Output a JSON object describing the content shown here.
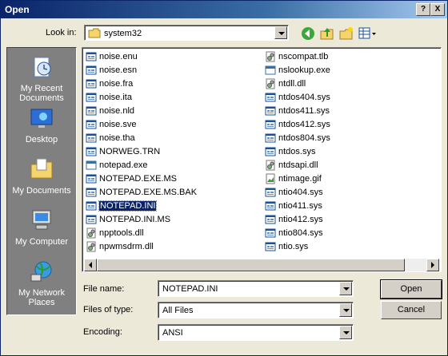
{
  "window": {
    "title": "Open",
    "help_label": "?",
    "close_label": "X"
  },
  "lookin": {
    "label": "Look in:",
    "value": "system32"
  },
  "places": [
    {
      "label": "My Recent Documents",
      "icon": "recent-documents-icon"
    },
    {
      "label": "Desktop",
      "icon": "desktop-icon"
    },
    {
      "label": "My Documents",
      "icon": "my-documents-icon"
    },
    {
      "label": "My Computer",
      "icon": "my-computer-icon"
    },
    {
      "label": "My Network Places",
      "icon": "network-places-icon"
    }
  ],
  "files_col1": [
    "noise.enu",
    "noise.esn",
    "noise.fra",
    "noise.ita",
    "noise.nld",
    "noise.sve",
    "noise.tha",
    "NORWEG.TRN",
    "notepad.exe",
    "NOTEPAD.EXE.MS",
    "NOTEPAD.EXE.MS.BAK",
    "NOTEPAD.INI",
    "NOTEPAD.INI.MS",
    "npptools.dll",
    "npwmsdrm.dll"
  ],
  "files_col2": [
    "nscompat.tlb",
    "nslookup.exe",
    "ntdll.dll",
    "ntdos404.sys",
    "ntdos411.sys",
    "ntdos412.sys",
    "ntdos804.sys",
    "ntdos.sys",
    "ntdsapi.dll",
    "ntimage.gif",
    "ntio404.sys",
    "ntio411.sys",
    "ntio412.sys",
    "ntio804.sys",
    "ntio.sys"
  ],
  "selected_file": "NOTEPAD.INI",
  "form": {
    "filename_label": "File name:",
    "filename_value": "NOTEPAD.INI",
    "filetype_label": "Files of type:",
    "filetype_value": "All Files",
    "encoding_label": "Encoding:",
    "encoding_value": "ANSI"
  },
  "buttons": {
    "open": "Open",
    "cancel": "Cancel"
  }
}
